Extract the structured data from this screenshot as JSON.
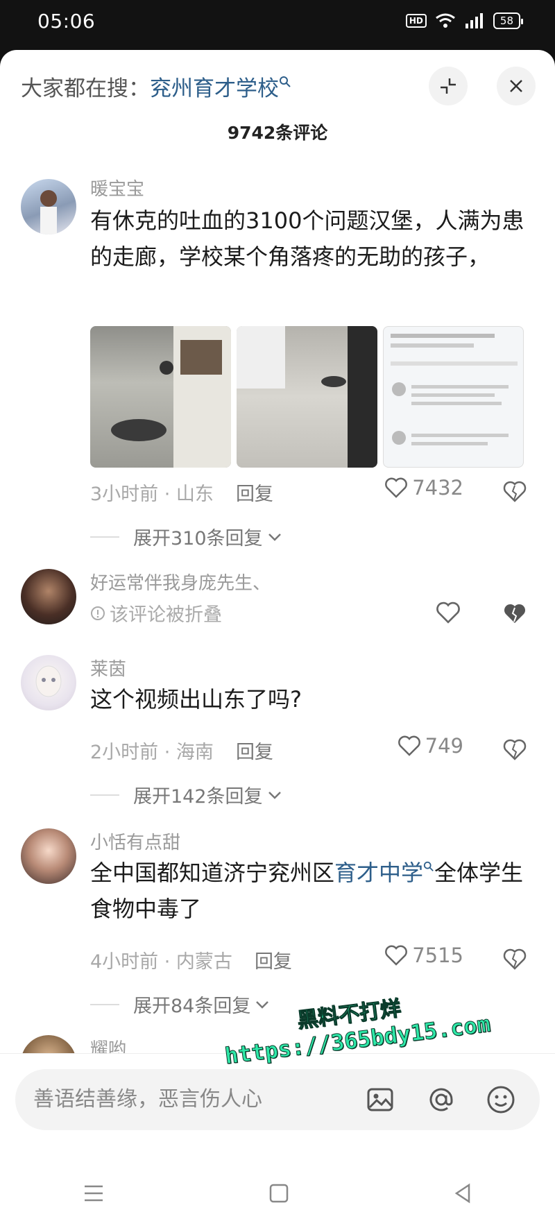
{
  "status_bar": {
    "time": "05:06",
    "hd": "HD",
    "battery": "58"
  },
  "header": {
    "search_prefix": "大家都在搜：",
    "search_term": "兖州育才学校",
    "comment_count": "9742条评论"
  },
  "comments": [
    {
      "user": "暖宝宝",
      "text": "有休克的吐血的3100个问题汉堡，人满为患的走廊，学校某个角落疼的无助的孩子，",
      "time_location": "3小时前 · 山东",
      "reply_label": "回复",
      "likes": "7432",
      "expand": "展开310条回复"
    },
    {
      "user": "好运常伴我身庞先生、",
      "folded_note": "该评论被折叠"
    },
    {
      "user": "莱茵",
      "text": "这个视频出山东了吗?",
      "time_location": "2小时前 · 海南",
      "reply_label": "回复",
      "likes": "749",
      "expand": "展开142条回复"
    },
    {
      "user": "小恬有点甜",
      "text_before": "全中国都知道济宁兖州区",
      "text_link": "育才中学",
      "text_after": "全体学生食物中毒了",
      "time_location": "4小时前 · 内蒙古",
      "reply_label": "回复",
      "likes": "7515",
      "expand": "展开84条回复"
    },
    {
      "user": "耀哟"
    }
  ],
  "input": {
    "placeholder": "善语结善缘，恶言伤人心"
  },
  "watermark": {
    "line1": "黑料不打烊",
    "line2": "https://365bdy15.com"
  }
}
